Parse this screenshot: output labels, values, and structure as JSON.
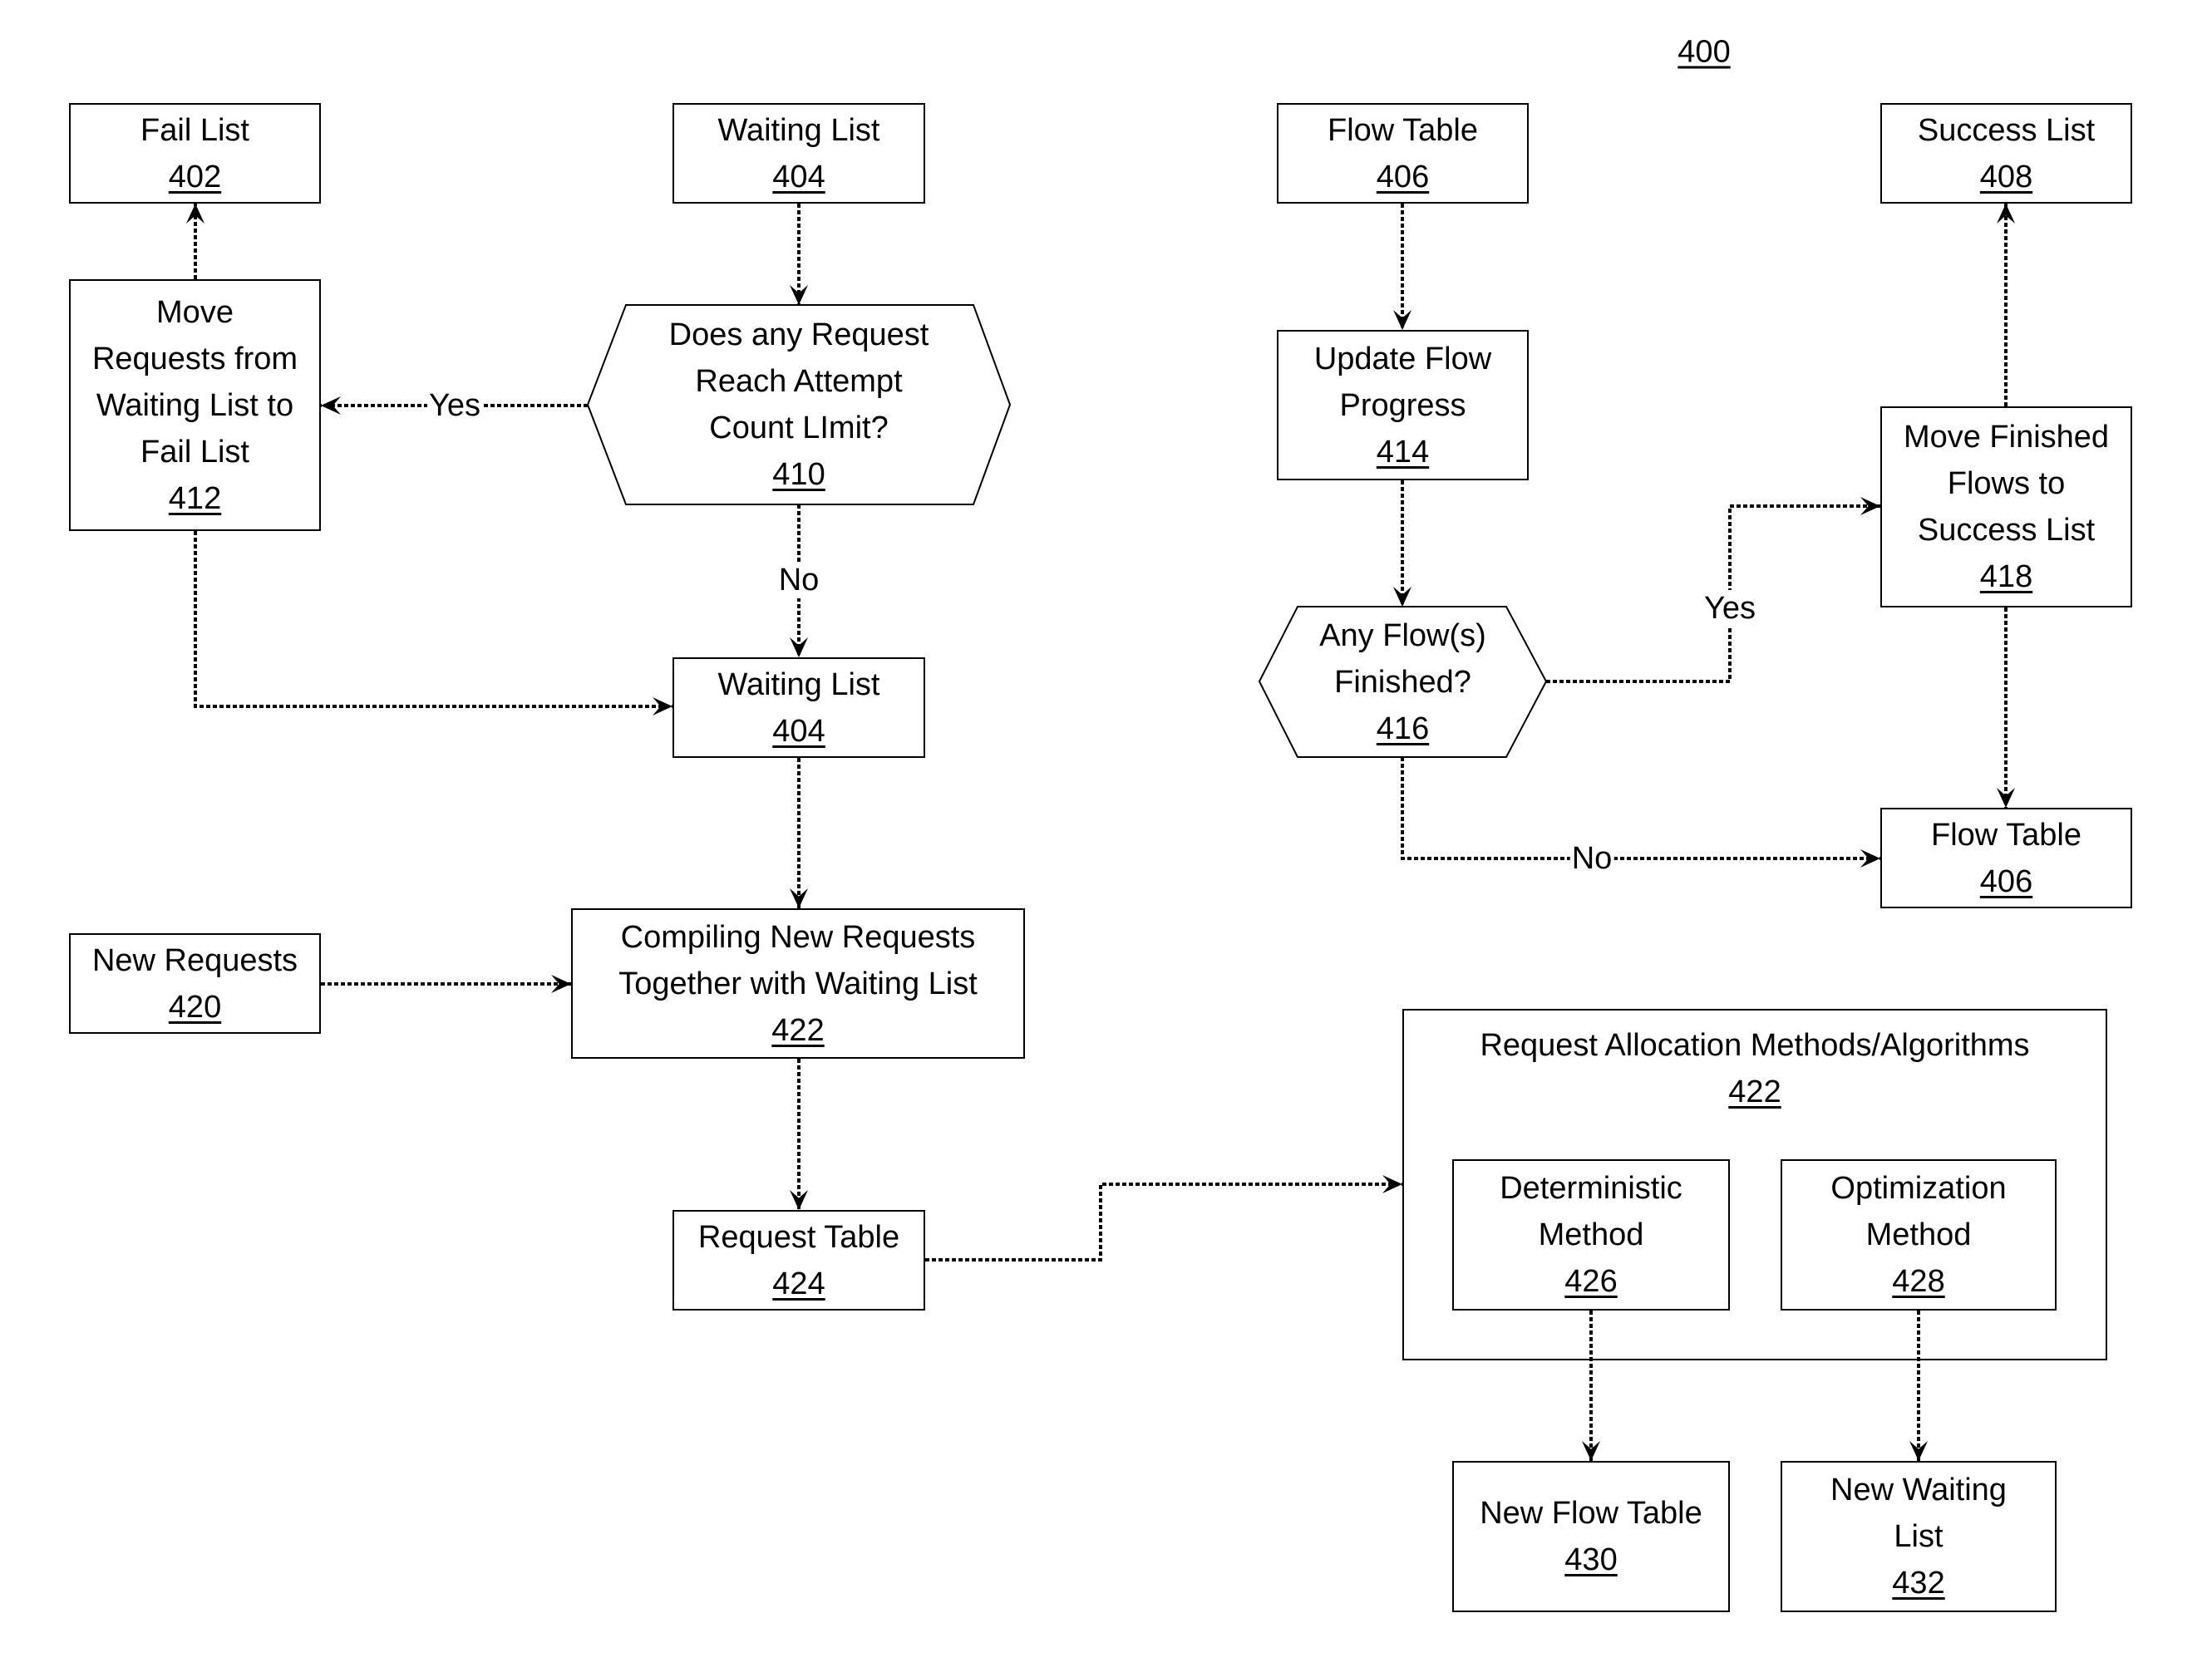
{
  "figure": {
    "number": "400"
  },
  "nodes": {
    "fail_list": {
      "lines": [
        "Fail List"
      ],
      "ref": "402"
    },
    "waiting_list_top": {
      "lines": [
        "Waiting List"
      ],
      "ref": "404"
    },
    "flow_table_top": {
      "lines": [
        "Flow Table"
      ],
      "ref": "406"
    },
    "success_list": {
      "lines": [
        "Success List"
      ],
      "ref": "408"
    },
    "move_to_fail": {
      "lines": [
        "Move",
        "Requests from",
        "Waiting List to",
        "Fail List"
      ],
      "ref": "412"
    },
    "attempt_limit": {
      "lines": [
        "Does any Request",
        "Reach Attempt",
        "Count LImit?"
      ],
      "ref": "410"
    },
    "update_flow": {
      "lines": [
        "Update Flow",
        "Progress"
      ],
      "ref": "414"
    },
    "flows_finished": {
      "lines": [
        "Any Flow(s)",
        "Finished?"
      ],
      "ref": "416"
    },
    "move_to_success": {
      "lines": [
        "Move Finished",
        "Flows to",
        "Success List"
      ],
      "ref": "418"
    },
    "waiting_list_mid": {
      "lines": [
        "Waiting List"
      ],
      "ref": "404"
    },
    "flow_table_right": {
      "lines": [
        "Flow Table"
      ],
      "ref": "406"
    },
    "new_requests": {
      "lines": [
        "New Requests"
      ],
      "ref": "420"
    },
    "compiling": {
      "lines": [
        "Compiling New Requests",
        "Together with Waiting List"
      ],
      "ref": "422"
    },
    "request_table": {
      "lines": [
        "Request Table"
      ],
      "ref": "424"
    },
    "allocation": {
      "lines": [
        "Request Allocation Methods/Algorithms"
      ],
      "ref": "422"
    },
    "deterministic": {
      "lines": [
        "Deterministic",
        "Method"
      ],
      "ref": "426"
    },
    "optimization": {
      "lines": [
        "Optimization",
        "Method"
      ],
      "ref": "428"
    },
    "new_flow_table": {
      "lines": [
        "New Flow Table"
      ],
      "ref": "430"
    },
    "new_waiting_list": {
      "lines": [
        "New Waiting",
        "List"
      ],
      "ref": "432"
    }
  },
  "edge_labels": {
    "attempt_yes": "Yes",
    "attempt_no": "No",
    "finished_yes": "Yes",
    "finished_no": "No"
  },
  "edges": [
    {
      "from": "waiting_list_top",
      "to": "attempt_limit"
    },
    {
      "from": "attempt_limit",
      "to": "move_to_fail",
      "label": "Yes"
    },
    {
      "from": "attempt_limit",
      "to": "waiting_list_mid",
      "label": "No"
    },
    {
      "from": "move_to_fail",
      "to": "fail_list"
    },
    {
      "from": "move_to_fail",
      "to": "waiting_list_mid"
    },
    {
      "from": "waiting_list_mid",
      "to": "compiling"
    },
    {
      "from": "new_requests",
      "to": "compiling"
    },
    {
      "from": "compiling",
      "to": "request_table"
    },
    {
      "from": "request_table",
      "to": "allocation"
    },
    {
      "from": "deterministic",
      "to": "new_flow_table"
    },
    {
      "from": "optimization",
      "to": "new_waiting_list"
    },
    {
      "from": "flow_table_top",
      "to": "update_flow"
    },
    {
      "from": "update_flow",
      "to": "flows_finished"
    },
    {
      "from": "flows_finished",
      "to": "move_to_success",
      "label": "Yes"
    },
    {
      "from": "flows_finished",
      "to": "flow_table_right",
      "label": "No"
    },
    {
      "from": "move_to_success",
      "to": "success_list"
    },
    {
      "from": "move_to_success",
      "to": "flow_table_right"
    }
  ]
}
